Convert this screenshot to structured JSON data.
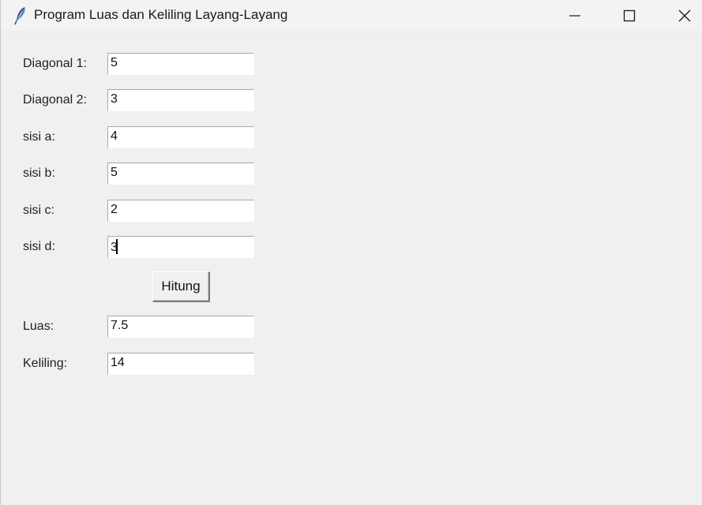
{
  "window": {
    "title": "Program Luas dan Keliling Layang-Layang"
  },
  "form": {
    "diagonal1": {
      "label": "Diagonal 1:",
      "value": "5"
    },
    "diagonal2": {
      "label": "Diagonal 2:",
      "value": "3"
    },
    "sisi_a": {
      "label": "sisi a:",
      "value": "4"
    },
    "sisi_b": {
      "label": "sisi b:",
      "value": "5"
    },
    "sisi_c": {
      "label": "sisi c:",
      "value": "2"
    },
    "sisi_d": {
      "label": "sisi d:",
      "value": "3"
    }
  },
  "action": {
    "hitung_label": "Hitung"
  },
  "results": {
    "luas": {
      "label": "Luas:",
      "value": "7.5"
    },
    "keliling": {
      "label": "Keliling:",
      "value": "14"
    }
  }
}
